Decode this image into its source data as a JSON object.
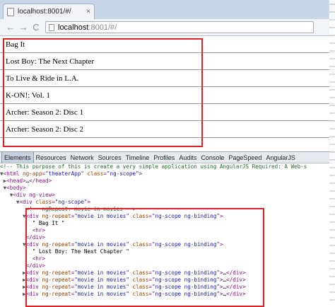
{
  "browser": {
    "tab_title": "localhost:8001/#/",
    "tab_close": "×",
    "back": "←",
    "forward": "→",
    "reload": "C",
    "url_host": "localhost",
    "url_rest": ":8001/#/"
  },
  "movies": [
    "Bag It",
    "Lost Boy: The Next Chapter",
    "To Live & Ride in L.A.",
    "K-ON!: Vol. 1",
    "Archer: Season 2: Disc 1",
    "Archer: Season 2: Disc 2"
  ],
  "devtools": {
    "tabs": [
      "Elements",
      "Resources",
      "Network",
      "Sources",
      "Timeline",
      "Profiles",
      "Audits",
      "Console",
      "PageSpeed",
      "AngularJS"
    ]
  },
  "code_lines": [
    "<!-- This purpose of this is create a very simple application using AngularJS Required: A Web-s",
    "▼<html ng-app=\"theaterApp\" class=\"ng-scope\">",
    " ▶<head>…</head>",
    " ▼<body>",
    "   ▼<div ng-view>",
    "     ▼<div class=\"ng-scope\">",
    "        <!-- ngRepeat: movie in movies -->",
    "       ▼<div ng-repeat=\"movie in movies\" class=\"ng-scope ng-binding\">",
    "          \" Bag It \"",
    "          <hr>",
    "        </div>",
    "       ▼<div ng-repeat=\"movie in movies\" class=\"ng-scope ng-binding\">",
    "          \" Lost Boy: The Next Chapter \"",
    "          <hr>",
    "        </div>",
    "       ▶<div ng-repeat=\"movie in movies\" class=\"ng-scope ng-binding\">…</div>",
    "       ▶<div ng-repeat=\"movie in movies\" class=\"ng-scope ng-binding\">…</div>",
    "       ▶<div ng-repeat=\"movie in movies\" class=\"ng-scope ng-binding\">…</div>",
    "       ▶<div ng-repeat=\"movie in movies\" class=\"ng-scope ng-binding\">…</div>"
  ]
}
